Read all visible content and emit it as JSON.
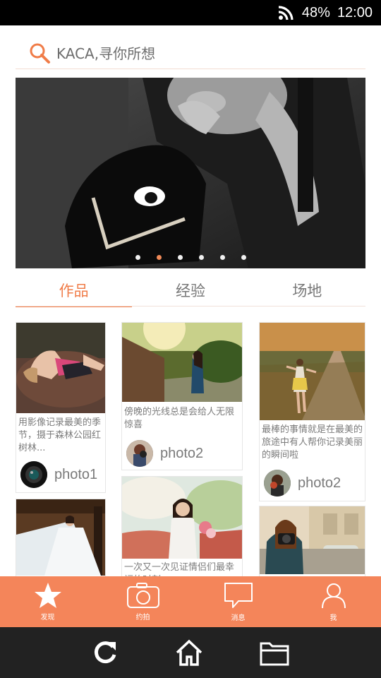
{
  "status": {
    "battery": "48%",
    "time": "12:00"
  },
  "search": {
    "placeholder": "KACA,寻你所想"
  },
  "banner": {
    "dot_count": 6,
    "active_index": 1
  },
  "tabs": [
    {
      "label": "作品",
      "active": true
    },
    {
      "label": "经验",
      "active": false
    },
    {
      "label": "场地",
      "active": false
    }
  ],
  "cards": [
    {
      "desc": "用影像记录最美的季节，摄于森林公园红树林...",
      "author": "photo1"
    },
    {
      "desc": "傍晚的光线总是会给人无限惊喜",
      "author": "photo2"
    },
    {
      "desc": "最棒的事情就是在最美的旅途中有人帮你记录美丽的瞬间啦",
      "author": "photo2"
    },
    {
      "desc": "",
      "author": ""
    },
    {
      "desc": "一次又一次见证情侣们最幸福的时刻",
      "author": ""
    },
    {
      "desc": "",
      "author": ""
    }
  ],
  "bottom_tabs": [
    {
      "label": "发现",
      "icon": "star-icon"
    },
    {
      "label": "约拍",
      "icon": "camera-icon"
    },
    {
      "label": "消息",
      "icon": "message-icon"
    },
    {
      "label": "我",
      "icon": "user-icon"
    }
  ],
  "colors": {
    "accent": "#f4855a",
    "tab_active": "#f07c48"
  }
}
